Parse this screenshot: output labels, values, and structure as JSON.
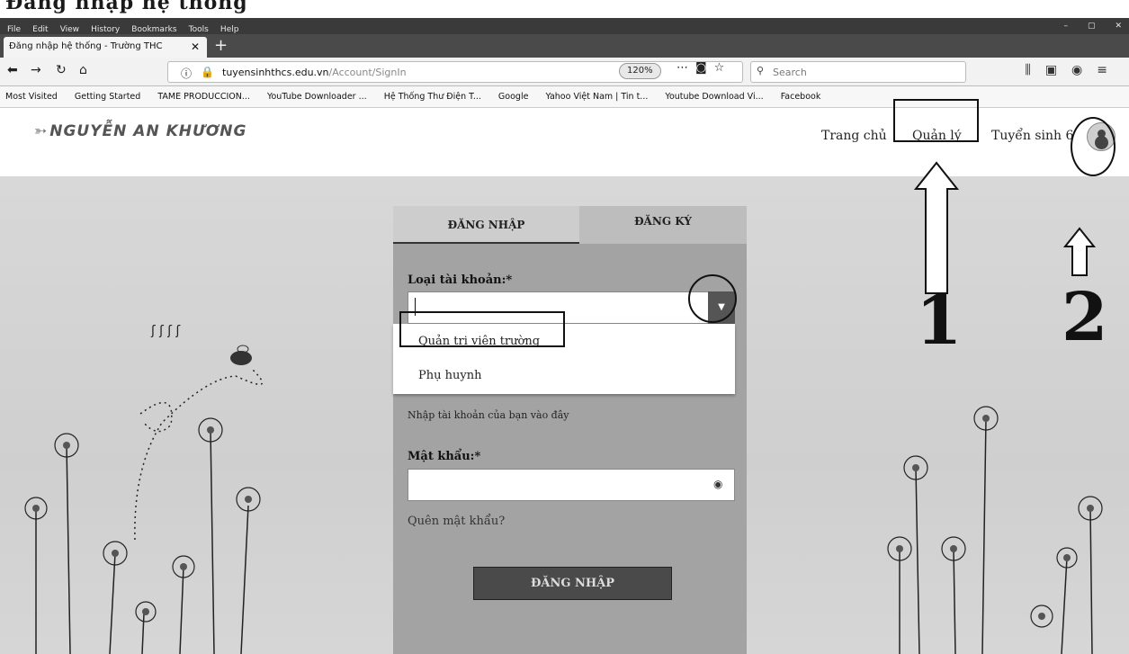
{
  "browser": {
    "menu": [
      "File",
      "Edit",
      "View",
      "History",
      "Bookmarks",
      "Tools",
      "Help"
    ],
    "window_controls": [
      "–",
      "▢",
      "✕"
    ],
    "tab": {
      "title": "Đăng nhập hệ thống - Trường THC",
      "close": "✕"
    },
    "new_tab": "+",
    "url": {
      "domain": "tuyensinhthcs.edu.vn",
      "path": "/Account/SignIn"
    },
    "zoom": "120%",
    "search_placeholder": "Search",
    "bookmarks": [
      "Most Visited",
      "Getting Started",
      "TAME PRODUCCION...",
      "YouTube Downloader ...",
      "Hệ Thống Thư Điện T...",
      "Google",
      "Yahoo Việt Nam | Tin t...",
      "Youtube Download Vi...",
      "Facebook"
    ]
  },
  "site": {
    "logo": "NGUYỄN AN KHƯƠNG",
    "nav": [
      "Trang chủ",
      "Quản lý",
      "Tuyển sinh 6"
    ]
  },
  "login": {
    "tabs": [
      "ĐĂNG NHẬP",
      "ĐĂNG KÝ"
    ],
    "account_type_label": "Loại tài khoản:*",
    "account_options": [
      "Quản trị viên trường",
      "Phụ huynh"
    ],
    "account_hint": "Nhập tài khoản của bạn vào đây",
    "password_label": "Mật khẩu:*",
    "forgot": "Quên mật khẩu?",
    "submit": "ĐĂNG NHẬP"
  },
  "annotations": {
    "marker1": "1",
    "marker2": "2"
  },
  "colors": {
    "page_bg": "#d6d6d6",
    "card_bg": "#a3a3a3",
    "button_bg": "#4a4a4a"
  }
}
